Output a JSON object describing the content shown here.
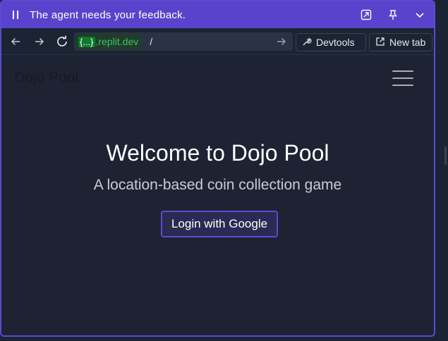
{
  "banner": {
    "message": "The agent needs your feedback.",
    "icons": [
      "pause-icon",
      "open-external-icon",
      "pin-icon",
      "chevron-down-icon"
    ]
  },
  "urlbar": {
    "domain_badge": "{...}",
    "domain": ".replit.dev",
    "path": "/",
    "devtools_label": "Devtools",
    "newtab_label": "New tab"
  },
  "app": {
    "brand": "Dojo Pool",
    "title": "Welcome to Dojo Pool",
    "subtitle": "A location-based coin collection game",
    "login_label": "Login with Google"
  },
  "colors": {
    "banner": "#5a43cc",
    "accent": "#5b4bcf",
    "background": "#1e2334",
    "domain_text": "#3fbf6a"
  }
}
